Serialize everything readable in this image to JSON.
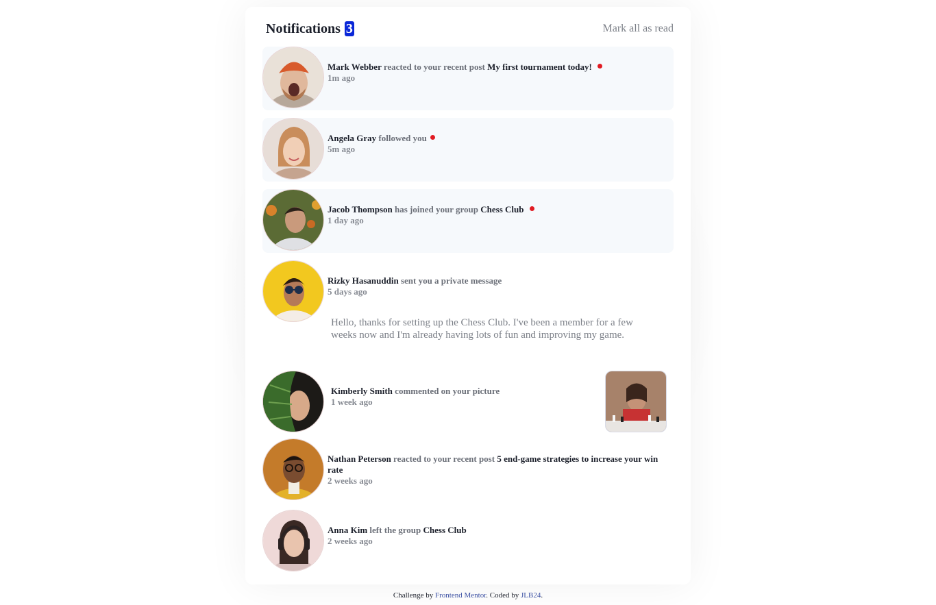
{
  "header": {
    "title": "Notifications",
    "unread_count": "3",
    "mark_all_label": "Mark all as read"
  },
  "notifications": [
    {
      "name": "Mark Webber",
      "action": "reacted to your recent post",
      "object": "My first tournament today!",
      "time": "1m ago",
      "unread": true
    },
    {
      "name": "Angela Gray",
      "action": "followed you",
      "object": "",
      "time": "5m ago",
      "unread": true
    },
    {
      "name": "Jacob Thompson",
      "action": "has joined your group",
      "object": "Chess Club",
      "time": "1 day ago",
      "unread": true
    },
    {
      "name": "Rizky Hasanuddin",
      "action": "sent you a private message",
      "object": "",
      "time": "5 days ago",
      "message": "Hello, thanks for setting up the Chess Club. I've been a member for a few weeks now and I'm already having lots of fun and improving my game.",
      "unread": false
    },
    {
      "name": "Kimberly Smith",
      "action": "commented on your picture",
      "object": "",
      "time": "1 week ago",
      "unread": false
    },
    {
      "name": "Nathan Peterson",
      "action": "reacted to your recent post",
      "object": "5 end-game strategies to increase your win rate",
      "time": "2 weeks ago",
      "unread": false
    },
    {
      "name": "Anna Kim",
      "action": "left the group",
      "object": "Chess Club",
      "time": "2 weeks ago",
      "unread": false
    }
  ],
  "footer": {
    "prefix": "Challenge by",
    "link1": "Frontend Mentor",
    "middle": ". Coded by",
    "link2": "JLB24",
    "suffix": "."
  },
  "colors": {
    "accent_badge": "#0a27d8",
    "unread_dot": "#e11b22",
    "unread_bg": "#f6f9fc"
  }
}
